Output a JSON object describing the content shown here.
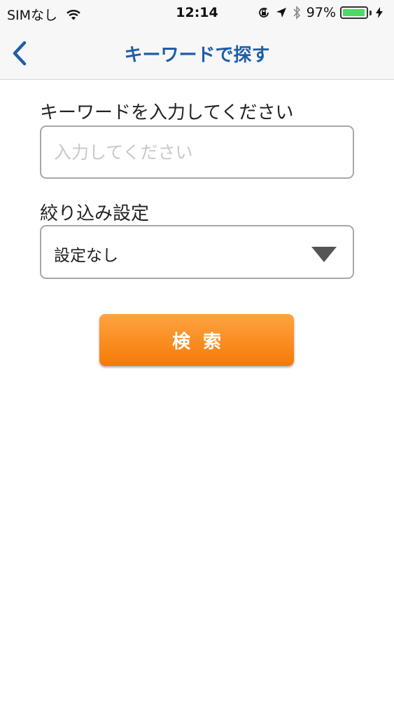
{
  "status_bar": {
    "carrier": "SIMなし",
    "time": "12:14",
    "battery_percent": "97%",
    "battery_level": 0.97,
    "battery_color": "#4cd964",
    "icons": [
      "wifi-icon",
      "orientation-lock-icon",
      "location-arrow-icon",
      "bluetooth-icon",
      "battery-icon",
      "charging-bolt-icon"
    ]
  },
  "nav": {
    "title": "キーワードで探す",
    "back_icon": "chevron-left-icon",
    "title_color": "#1f5ea8"
  },
  "form": {
    "keyword_label": "キーワードを入力してください",
    "keyword_value": "",
    "keyword_placeholder": "入力してください",
    "filter_label": "絞り込み設定",
    "filter_value": "設定なし",
    "filter_icon": "dropdown-triangle-icon",
    "search_button_label": "検索",
    "search_button_color": "#f57a07"
  }
}
